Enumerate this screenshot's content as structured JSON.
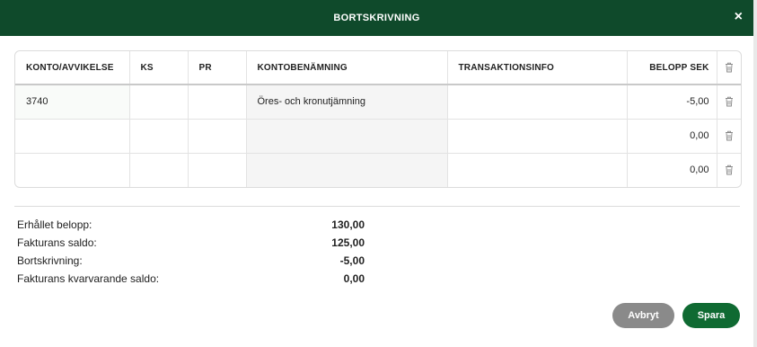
{
  "dialog": {
    "title": "BORTSKRIVNING",
    "close_label": "×"
  },
  "table": {
    "headers": [
      "KONTO/AVVIKELSE",
      "KS",
      "PR",
      "KONTOBENÄMNING",
      "TRANSAKTIONSINFO",
      "BELOPP SEK"
    ],
    "rows": [
      {
        "konto": "3740",
        "ks": "",
        "pr": "",
        "benamning": "Öres- och kronutjämning",
        "info": "",
        "belopp": "-5,00"
      },
      {
        "konto": "",
        "ks": "",
        "pr": "",
        "benamning": "",
        "info": "",
        "belopp": "0,00"
      },
      {
        "konto": "",
        "ks": "",
        "pr": "",
        "benamning": "",
        "info": "",
        "belopp": "0,00"
      }
    ]
  },
  "summary": [
    {
      "label": "Erhållet belopp:",
      "value": "130,00"
    },
    {
      "label": "Fakturans saldo:",
      "value": "125,00"
    },
    {
      "label": "Bortskrivning:",
      "value": "-5,00"
    },
    {
      "label": "Fakturans kvarvarande saldo:",
      "value": "0,00"
    }
  ],
  "buttons": {
    "cancel": "Avbryt",
    "save": "Spara"
  },
  "colors": {
    "header_bg": "#0f4a2b",
    "save_bg": "#0f6a32",
    "cancel_bg": "#8a8a8a"
  },
  "icons": {
    "delete": "trash-icon",
    "close": "close-icon"
  }
}
